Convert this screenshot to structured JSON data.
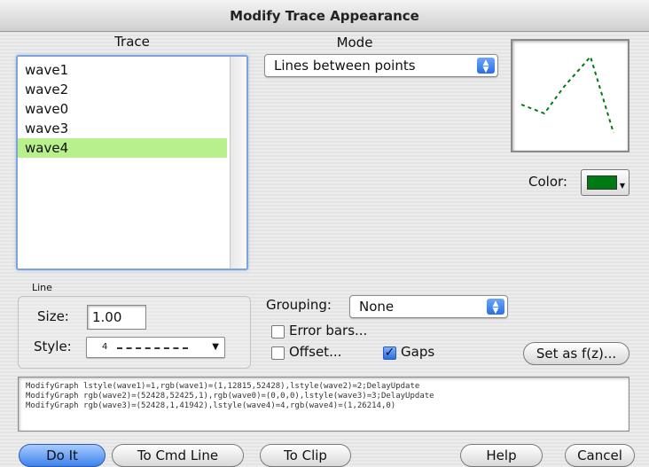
{
  "window": {
    "title": "Modify Trace Appearance"
  },
  "trace": {
    "heading": "Trace",
    "items": [
      {
        "label": "wave1",
        "selected": false
      },
      {
        "label": "wave2",
        "selected": false
      },
      {
        "label": "wave0",
        "selected": false
      },
      {
        "label": "wave3",
        "selected": false
      },
      {
        "label": "wave4",
        "selected": true
      }
    ]
  },
  "mode": {
    "heading": "Mode",
    "value": "Lines between points"
  },
  "preview": {
    "line_color": "#007a14",
    "style": "dashed"
  },
  "color": {
    "label": "Color:",
    "value": "#007a14"
  },
  "line": {
    "heading": "Line",
    "size_label": "Size:",
    "size_value": "1.00",
    "style_label": "Style:",
    "style_value": "4"
  },
  "grouping": {
    "label": "Grouping:",
    "value": "None"
  },
  "options": {
    "error_bars_label": "Error bars...",
    "error_bars_checked": false,
    "offset_label": "Offset...",
    "offset_checked": false,
    "gaps_label": "Gaps",
    "gaps_checked": true
  },
  "set_fz_label": "Set as f(z)...",
  "command_text": {
    "line1": "ModifyGraph lstyle(wave1)=1,rgb(wave1)=(1,12815,52428),lstyle(wave2)=2;DelayUpdate",
    "line2": "ModifyGraph rgb(wave2)=(52428,52425,1),rgb(wave0)=(0,0,0),lstyle(wave3)=3;DelayUpdate",
    "line3": "ModifyGraph rgb(wave3)=(52428,1,41942),lstyle(wave4)=4,rgb(wave4)=(1,26214,0)"
  },
  "buttons": {
    "do_it": "Do It",
    "to_cmd_line": "To Cmd Line",
    "to_clip": "To Clip",
    "help": "Help",
    "cancel": "Cancel"
  },
  "icons": {
    "popup_arrows": "updown-arrows-icon",
    "checkmark": "checkmark-icon",
    "dropdown": "triangle-down-icon"
  }
}
